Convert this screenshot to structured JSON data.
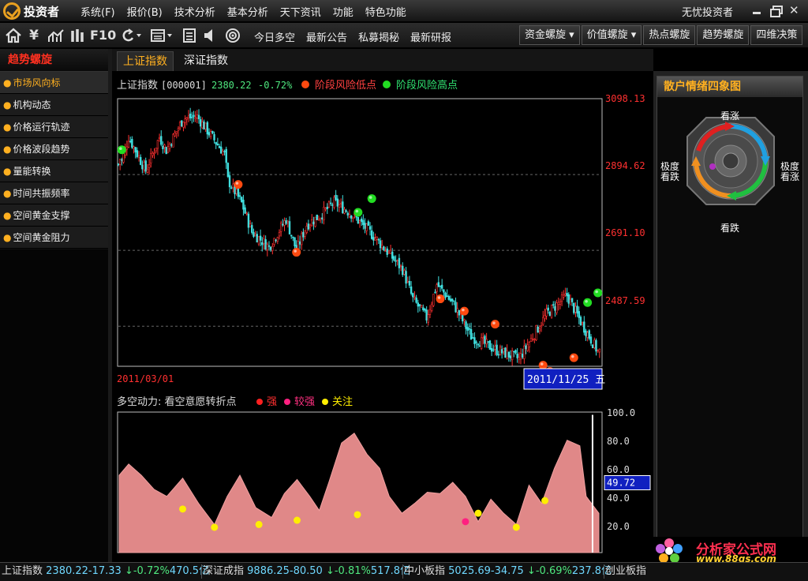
{
  "app": {
    "name": "投资者",
    "user": "无忧投资者"
  },
  "menu": [
    "系统(F)",
    "报价(B)",
    "技术分析",
    "基本分析",
    "天下资讯",
    "功能",
    "特色功能"
  ],
  "toolbar": {
    "icons": [
      "home-icon",
      "yen-icon",
      "trend-icon",
      "bars-icon",
      "F10",
      "refresh-icon",
      "window-icon",
      "list-icon",
      "sound-icon",
      "target-icon"
    ],
    "f10": "F10",
    "links": [
      "今日多空",
      "最新公告",
      "私募揭秘",
      "最新研报"
    ],
    "right_buttons": [
      "资金螺旋 ▾",
      "价值螺旋 ▾",
      "热点螺旋",
      "趋势螺旋",
      "四维决策"
    ]
  },
  "left_panel": {
    "title": "趋势螺旋",
    "items": [
      "市场风向标",
      "机构动态",
      "价格运行轨迹",
      "价格波段趋势",
      "量能转换",
      "时间共振频率",
      "空间黄金支撑",
      "空间黄金阻力"
    ],
    "bullet": "●"
  },
  "tabs": [
    "上证指数",
    "深证指数"
  ],
  "main_chart": {
    "name": "上证指数",
    "code": "[000001]",
    "price": "2380.22",
    "change_pct": "-0.72%",
    "legend_low": "阶段风险低点",
    "legend_high": "阶段风险高点",
    "start_date": "2011/03/01",
    "cursor_date": "2011/11/25 五",
    "ylabels": [
      "3098.13",
      "2894.62",
      "2691.10",
      "2487.59"
    ]
  },
  "lower_chart": {
    "title": "多空动力: 看空意愿转折点",
    "legend": [
      "强",
      "较强",
      "关注"
    ],
    "ylabels": [
      "100.0",
      "80.0",
      "60.0",
      "40.0",
      "20.0"
    ],
    "current_value": "49.72"
  },
  "chart_data": [
    {
      "type": "candlestick",
      "title": "上证指数 [000001]",
      "x_range": [
        "2011/03/01",
        "2011/11/25"
      ],
      "ylim": [
        2380,
        3098.13
      ],
      "y_ticks": [
        3098.13,
        2894.62,
        2691.1,
        2487.59
      ],
      "close_path_index": [
        0,
        0,
        2,
        6,
        16,
        24,
        28,
        38,
        46,
        62,
        64,
        72,
        78,
        88,
        98,
        104,
        110,
        118,
        126,
        136,
        150,
        166,
        172,
        180,
        186,
        196,
        206,
        220,
        234,
        250,
        262,
        270,
        280
      ],
      "close_path_value": [
        2922,
        2945,
        2930,
        2995,
        2905,
        2995,
        2960,
        3045,
        3050,
        2950,
        2880,
        2818,
        2740,
        2700,
        2775,
        2690,
        2760,
        2785,
        2820,
        2790,
        2725,
        2640,
        2560,
        2510,
        2600,
        2545,
        2460,
        2425,
        2400,
        2520,
        2570,
        2500,
        2420
      ],
      "series": [
        {
          "name": "阶段风险低点",
          "color": "#ff4a10",
          "x_index": [
            70,
            104,
            188,
            202,
            220,
            248,
            252,
            266
          ],
          "y": [
            2868,
            2686,
            2561,
            2528,
            2493,
            2383,
            2366,
            2403
          ]
        },
        {
          "name": "阶段风险高点",
          "color": "#22dd22",
          "x_index": [
            2,
            140,
            148,
            274,
            280
          ],
          "y": [
            2961,
            2793,
            2830,
            2551,
            2577
          ]
        }
      ]
    },
    {
      "type": "area",
      "title": "多空动力: 看空意愿转折点",
      "ylim": [
        0,
        100
      ],
      "y_ticks": [
        100,
        80,
        60,
        40,
        20
      ],
      "current_value": 49.72,
      "x_index": [
        0,
        6,
        14,
        22,
        30,
        40,
        50,
        60,
        68,
        76,
        86,
        96,
        104,
        112,
        120,
        126,
        132,
        140,
        148,
        156,
        164,
        170,
        178,
        186,
        194,
        202,
        210,
        218,
        226,
        234,
        242,
        250,
        258,
        266,
        274,
        282,
        290,
        294,
        298,
        302
      ],
      "values": [
        55,
        63,
        55,
        45,
        40,
        53,
        35,
        20,
        40,
        55,
        32,
        25,
        42,
        52,
        40,
        30,
        50,
        78,
        85,
        70,
        60,
        40,
        28,
        35,
        43,
        42,
        50,
        40,
        22,
        38,
        28,
        20,
        48,
        35,
        60,
        80,
        76,
        40,
        98,
        28
      ],
      "series": [
        {
          "name": "强",
          "color": "#ff2020",
          "x_index": [],
          "y": []
        },
        {
          "name": "较强",
          "color": "#ff2080",
          "x_index": [
            218
          ],
          "y": [
            22
          ]
        },
        {
          "name": "关注",
          "color": "#ffee00",
          "x_index": [
            40,
            60,
            88,
            112,
            150,
            226,
            250,
            268
          ],
          "y": [
            31,
            18,
            20,
            23,
            27,
            28,
            18,
            37
          ]
        }
      ]
    }
  ],
  "right_panel": {
    "title": "散户情绪四象图",
    "labels": {
      "top": "看涨",
      "left": "极度\n看跌",
      "right": "极度\n看涨",
      "bottom": "看跌"
    }
  },
  "watermark": {
    "title": "分析家公式网",
    "url": "www.88gs.com"
  },
  "statusbar": [
    {
      "name": "上证指数",
      "value": "2380.22-17.33",
      "change": "↓-0.72%",
      "volume": "470.5亿"
    },
    {
      "name": "深证成指",
      "value": "9886.25-80.50",
      "change": "↓-0.81%",
      "volume": "517.8亿"
    },
    {
      "name": "中小板指",
      "value": "5025.69-34.75",
      "change": "↓-0.69%",
      "volume": "237.8亿"
    },
    {
      "name": "创业板指",
      "value": "",
      "change": "",
      "volume": ""
    }
  ]
}
